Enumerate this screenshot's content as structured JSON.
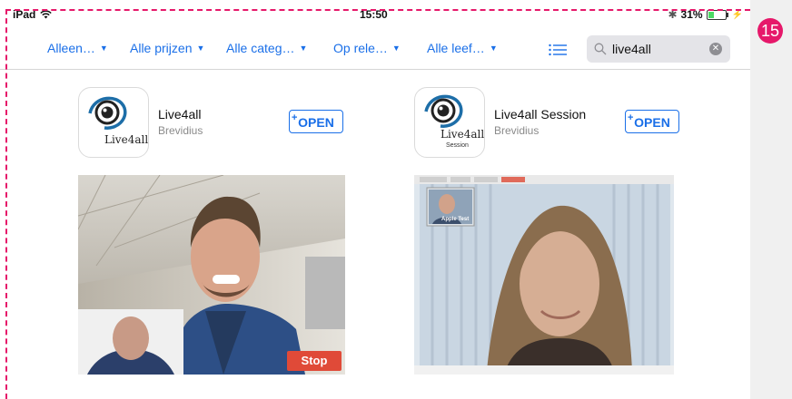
{
  "status_bar": {
    "device": "iPad",
    "time": "15:50",
    "battery": "31%",
    "battery_level": 0.31
  },
  "filters": [
    {
      "label": "Alleen…"
    },
    {
      "label": "Alle prijzen"
    },
    {
      "label": "Alle categ…"
    },
    {
      "label": "Op rele…"
    },
    {
      "label": "Alle leef…"
    }
  ],
  "search": {
    "value": "live4all"
  },
  "apps": [
    {
      "name": "Live4all",
      "developer": "Brevidius",
      "button": "OPEN",
      "icon_text": "Live4all",
      "icon_subtext": "",
      "screenshot_label": "Stop"
    },
    {
      "name": "Live4all Session",
      "developer": "Brevidius",
      "button": "OPEN",
      "icon_text": "Live4all",
      "icon_subtext": "Session",
      "screenshot_label": "Apple Test"
    }
  ],
  "step_badge": "15",
  "colors": {
    "accent": "#1a6fe8",
    "annotation": "#e6186a",
    "stop": "#e04a38"
  }
}
